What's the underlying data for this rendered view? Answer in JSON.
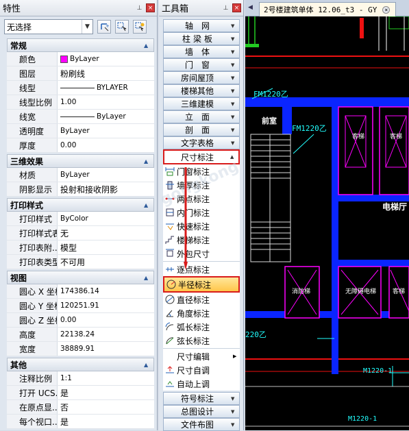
{
  "properties": {
    "title": "特性",
    "selection": "无选择",
    "sections": [
      {
        "name": "常规",
        "rows": [
          {
            "k": "颜色",
            "v": "ByLayer",
            "kind": "color"
          },
          {
            "k": "图层",
            "v": "粉刷线",
            "kind": "cn"
          },
          {
            "k": "线型",
            "v": "BYLAYER",
            "kind": "line"
          },
          {
            "k": "线型比例",
            "v": "1.00",
            "kind": "num"
          },
          {
            "k": "线宽",
            "v": "ByLayer",
            "kind": "line"
          },
          {
            "k": "透明度",
            "v": "ByLayer",
            "kind": "num"
          },
          {
            "k": "厚度",
            "v": "0.00",
            "kind": "num"
          }
        ]
      },
      {
        "name": "三维效果",
        "rows": [
          {
            "k": "材质",
            "v": "ByLayer",
            "kind": "num"
          },
          {
            "k": "阴影显示",
            "v": "投射和接收阴影",
            "kind": "cn"
          }
        ]
      },
      {
        "name": "打印样式",
        "rows": [
          {
            "k": "打印样式",
            "v": "ByColor",
            "kind": "num"
          },
          {
            "k": "打印样式表",
            "v": "无",
            "kind": "cn"
          },
          {
            "k": "打印表附...",
            "v": "模型",
            "kind": "cn"
          },
          {
            "k": "打印表类型",
            "v": "不可用",
            "kind": "cn"
          }
        ]
      },
      {
        "name": "视图",
        "rows": [
          {
            "k": "圆心 X 坐标",
            "v": "174386.14",
            "kind": "num"
          },
          {
            "k": "圆心 Y 坐标",
            "v": "120251.91",
            "kind": "num"
          },
          {
            "k": "圆心 Z 坐标",
            "v": "0.00",
            "kind": "num"
          },
          {
            "k": "高度",
            "v": "22138.24",
            "kind": "num"
          },
          {
            "k": "宽度",
            "v": "38889.91",
            "kind": "num"
          }
        ]
      },
      {
        "name": "其他",
        "rows": [
          {
            "k": "注释比例",
            "v": "1:1",
            "kind": "num"
          },
          {
            "k": "打开 UCS...",
            "v": "是",
            "kind": "cn"
          },
          {
            "k": "在原点显...",
            "v": "否",
            "kind": "cn"
          },
          {
            "k": "每个视口...",
            "v": "是",
            "kind": "cn"
          }
        ]
      }
    ]
  },
  "toolbox": {
    "title": "工具箱",
    "menus_top": [
      {
        "label": "轴网",
        "style": "spaced"
      },
      {
        "label": "柱梁板",
        "style": "mid"
      },
      {
        "label": "墙体",
        "style": "spaced"
      },
      {
        "label": "门窗",
        "style": "spaced"
      },
      {
        "label": "房间屋顶",
        "style": ""
      },
      {
        "label": "楼梯其他",
        "style": ""
      },
      {
        "label": "三维建模",
        "style": ""
      },
      {
        "label": "立面",
        "style": "spaced"
      },
      {
        "label": "剖面",
        "style": "spaced"
      },
      {
        "label": "文字表格",
        "style": ""
      }
    ],
    "open_menu": "尺寸标注",
    "sub_items_1": [
      {
        "label": "门窗标注",
        "icon": "door-window-dim-icon"
      },
      {
        "label": "墙厚标注",
        "icon": "wall-thickness-dim-icon"
      },
      {
        "label": "两点标注",
        "icon": "two-point-dim-icon"
      },
      {
        "label": "内门标注",
        "icon": "inner-door-dim-icon"
      },
      {
        "label": "快速标注",
        "icon": "quick-dim-icon"
      },
      {
        "label": "楼梯标注",
        "icon": "stair-dim-icon"
      },
      {
        "label": "外包尺寸",
        "icon": "outer-dim-icon"
      }
    ],
    "sub_items_2": [
      {
        "label": "逐点标注",
        "icon": "point-dim-icon"
      }
    ],
    "highlighted": {
      "label": "半径标注",
      "icon": "radius-dim-icon"
    },
    "sub_items_3": [
      {
        "label": "直径标注",
        "icon": "diameter-dim-icon"
      },
      {
        "label": "角度标注",
        "icon": "angle-dim-icon"
      },
      {
        "label": "弧长标注",
        "icon": "arc-length-dim-icon"
      },
      {
        "label": "弦长标注",
        "icon": "chord-length-dim-icon"
      }
    ],
    "sub_items_4": [
      {
        "label": "尺寸编辑",
        "icon": "",
        "arrow": true
      },
      {
        "label": "尺寸自调",
        "icon": "auto-adjust-icon"
      },
      {
        "label": "自动上调",
        "icon": "auto-up-icon"
      }
    ],
    "menus_bottom": [
      {
        "label": "符号标注",
        "style": ""
      },
      {
        "label": "总图设计",
        "style": ""
      },
      {
        "label": "文件布图",
        "style": ""
      }
    ]
  },
  "drawing": {
    "tab_title": "2号楼建筑单体 12.06_t3 - GY",
    "labels": {
      "fm1": "FM1220乙",
      "fm2": "FM1220乙",
      "room1": "前室",
      "room2": "电梯厅",
      "lift1": "客梯",
      "lift2": "客梯",
      "lift3": "消防梯",
      "lift4": "无障碍电梯",
      "lift5": "客梯",
      "m1": "M1220-1",
      "m2": "M1220-1",
      "door2": "220乙"
    }
  },
  "watermark": "gongkong"
}
